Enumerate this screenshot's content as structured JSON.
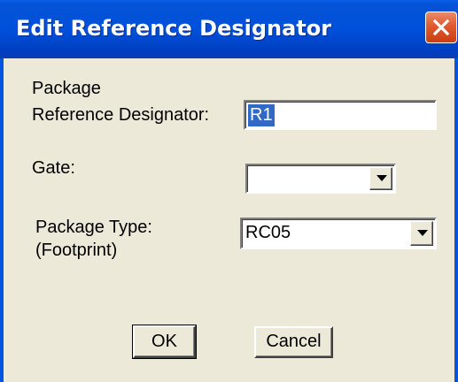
{
  "window": {
    "title": "Edit Reference Designator"
  },
  "form": {
    "ref_label_line1": "Package",
    "ref_label_line2": "Reference Designator:",
    "ref_value": "R1",
    "gate_label": "Gate:",
    "gate_value": "",
    "package_label_line1": "Package Type:",
    "package_label_line2": "(Footprint)",
    "package_value": "RC05"
  },
  "buttons": {
    "ok_label": "OK",
    "cancel_label": "Cancel"
  },
  "icons": {
    "close": "close-icon",
    "dropdown": "chevron-down-icon"
  },
  "colors": {
    "titlebar": "#0050db",
    "close_button": "#e0592f",
    "dialog_face": "#ece9d8",
    "selection": "#316ac5"
  }
}
